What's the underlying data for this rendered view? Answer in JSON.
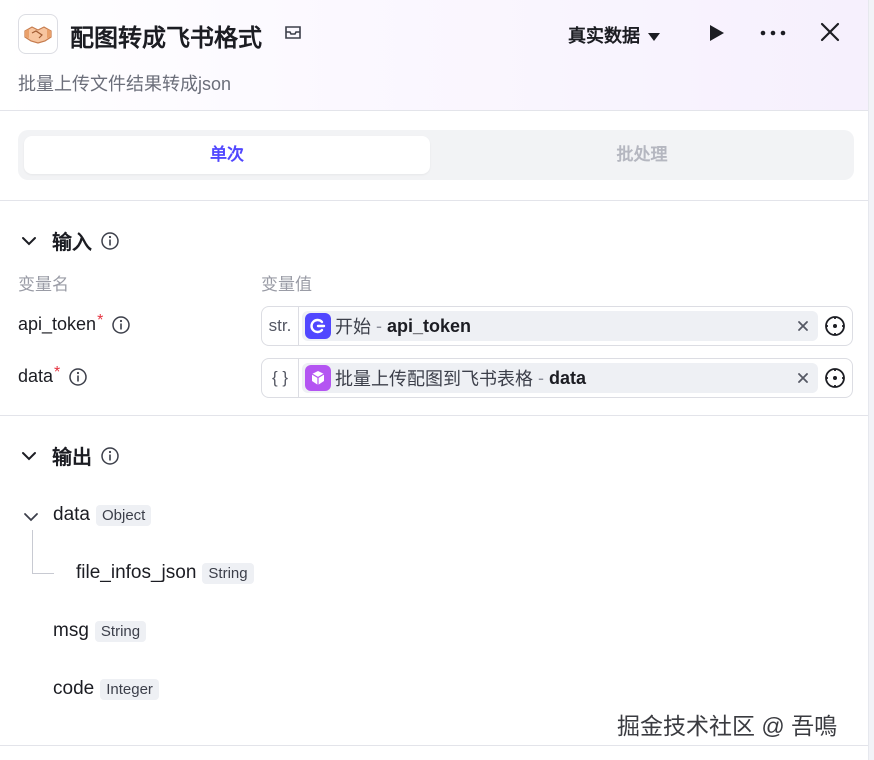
{
  "header": {
    "title": "配图转成飞书格式",
    "description": "批量上传文件结果转成json",
    "data_mode": "真实数据"
  },
  "tabs": [
    {
      "label": "单次",
      "active": true
    },
    {
      "label": "批处理",
      "active": false
    }
  ],
  "input": {
    "heading": "输入",
    "col_name": "变量名",
    "col_value": "变量值",
    "rows": [
      {
        "name": "api_token",
        "required": "*",
        "type": "str.",
        "source": "开始",
        "sep": "-",
        "var": "api_token",
        "icon_color": "#5147ff"
      },
      {
        "name": "data",
        "required": "*",
        "type": "{ }",
        "source": "批量上传配图到飞书表格",
        "sep": "-",
        "var": "data",
        "icon_color": "#b455f2"
      }
    ]
  },
  "output": {
    "heading": "输出",
    "items": [
      {
        "name": "data",
        "type": "Object"
      },
      {
        "name": "file_infos_json",
        "type": "String"
      },
      {
        "name": "msg",
        "type": "String"
      },
      {
        "name": "code",
        "type": "Integer"
      }
    ]
  },
  "watermark": "掘金技术社区 @ 吾鳴",
  "colors": {
    "accent": "#5147ff",
    "required": "#e5323f"
  }
}
